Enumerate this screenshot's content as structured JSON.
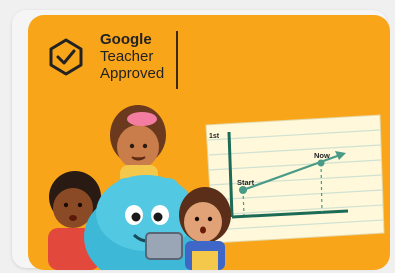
{
  "badge": {
    "brand": "Google",
    "line1": "Teacher",
    "line2": "Approved",
    "icon": "check-badge-icon"
  },
  "chart": {
    "y_tick": "1st",
    "start_label": "Start",
    "now_label": "Now"
  },
  "colors": {
    "card_background": "#F9A51A",
    "paper": "#FFF8DA",
    "paper_lines": "#CFE1D2",
    "axis": "#1B6B57",
    "trend": "#4A9A88"
  }
}
